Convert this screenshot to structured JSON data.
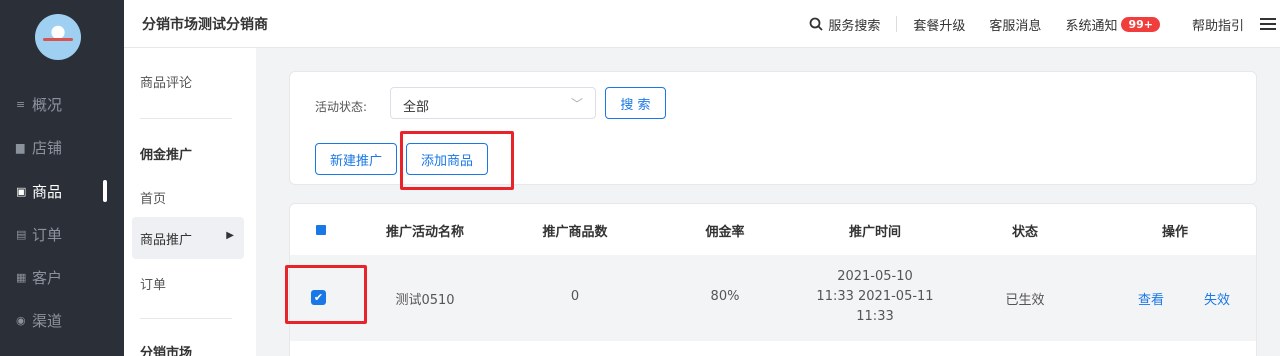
{
  "left_nav": {
    "items": [
      {
        "label": "概况",
        "icon": "overview-icon"
      },
      {
        "label": "店铺",
        "icon": "store-icon"
      },
      {
        "label": "商品",
        "icon": "goods-icon",
        "active": true
      },
      {
        "label": "订单",
        "icon": "order-icon"
      },
      {
        "label": "客户",
        "icon": "customer-icon"
      },
      {
        "label": "渠道",
        "icon": "channel-icon"
      }
    ]
  },
  "header": {
    "title": "分销市场测试分销商",
    "search_label": "服务搜索",
    "upgrade_label": "套餐升级",
    "service_msg_label": "客服消息",
    "notice_label": "系统通知",
    "notice_badge": "99+",
    "help_label": "帮助指引"
  },
  "subnav": {
    "review": "商品评论",
    "section_commission": "佣金推广",
    "home": "首页",
    "promotion": "商品推广",
    "orders": "订单",
    "section_market": "分销市场"
  },
  "filter": {
    "label": "活动状态:",
    "select_value": "全部",
    "search_button": "搜 索",
    "new_button": "新建推广",
    "add_button": "添加商品"
  },
  "table": {
    "headers": [
      "推广活动名称",
      "推广商品数",
      "佣金率",
      "推广时间",
      "状态",
      "操作"
    ],
    "rows": [
      {
        "name": "测试0510",
        "count": "0",
        "rate": "80%",
        "time_line1": "2021-05-10",
        "time_line2": "11:33 2021-05-11",
        "time_line3": "11:33",
        "status": "已生效",
        "action_view": "查看",
        "action_disable": "失效"
      }
    ]
  },
  "colors": {
    "accent": "#1a78e6",
    "nav_bg": "#2b2f38",
    "highlight": "#e8242a",
    "badge": "#f23d3d"
  }
}
